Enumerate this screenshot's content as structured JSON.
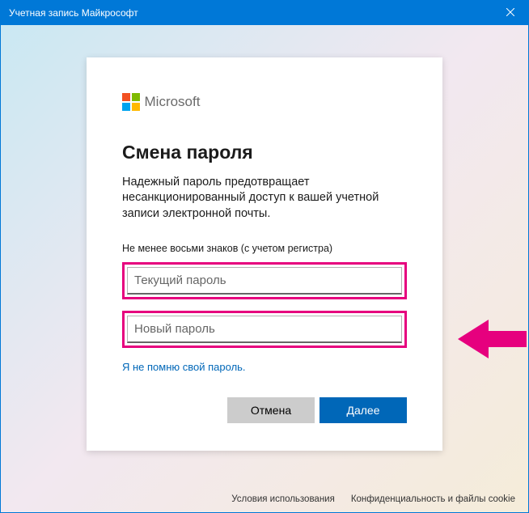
{
  "window": {
    "title": "Учетная запись Майкрософт"
  },
  "logo": {
    "word": "Microsoft"
  },
  "heading": "Смена пароля",
  "description": "Надежный пароль предотвращает несанкционированный доступ к вашей учетной записи электронной почты.",
  "hint": "Не менее восьми знаков (с учетом регистра)",
  "fields": {
    "current": {
      "placeholder": "Текущий пароль",
      "value": ""
    },
    "new": {
      "placeholder": "Новый пароль",
      "value": ""
    }
  },
  "forgot_link": "Я не помню свой пароль.",
  "buttons": {
    "cancel": "Отмена",
    "next": "Далее"
  },
  "footer": {
    "terms": "Условия использования",
    "privacy": "Конфиденциальность и файлы cookie"
  },
  "colors": {
    "accent": "#0078d7",
    "link": "#0067b8",
    "highlight": "#e6007e"
  }
}
